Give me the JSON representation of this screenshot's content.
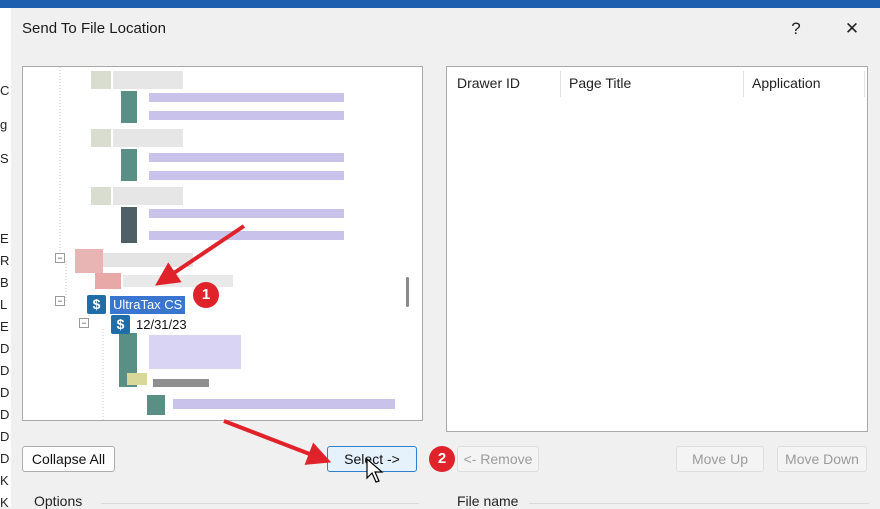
{
  "dialog": {
    "title": "Send To File Location",
    "help_label": "?",
    "close_label": "✕"
  },
  "background_edge": {
    "letters": [
      "C",
      "g",
      "S",
      "E",
      "R",
      "B",
      "L",
      "E",
      "D",
      "D",
      "D",
      "D",
      "D",
      "D",
      "K",
      "K"
    ]
  },
  "tree": {
    "selected_node": "UltraTax CS",
    "child_node": "12/31/23",
    "icon": "dollar-icon",
    "expander_label": "−"
  },
  "list": {
    "columns": [
      "Drawer ID",
      "Page Title",
      "Application"
    ]
  },
  "buttons": {
    "collapse_all": "Collapse All",
    "select": "Select ->",
    "remove": "<- Remove",
    "move_up": "Move Up",
    "move_down": "Move Down"
  },
  "groups": {
    "options": "Options",
    "file_name": "File name"
  },
  "annotations": {
    "step1": "1",
    "step2": "2",
    "color": "#e0222a"
  }
}
